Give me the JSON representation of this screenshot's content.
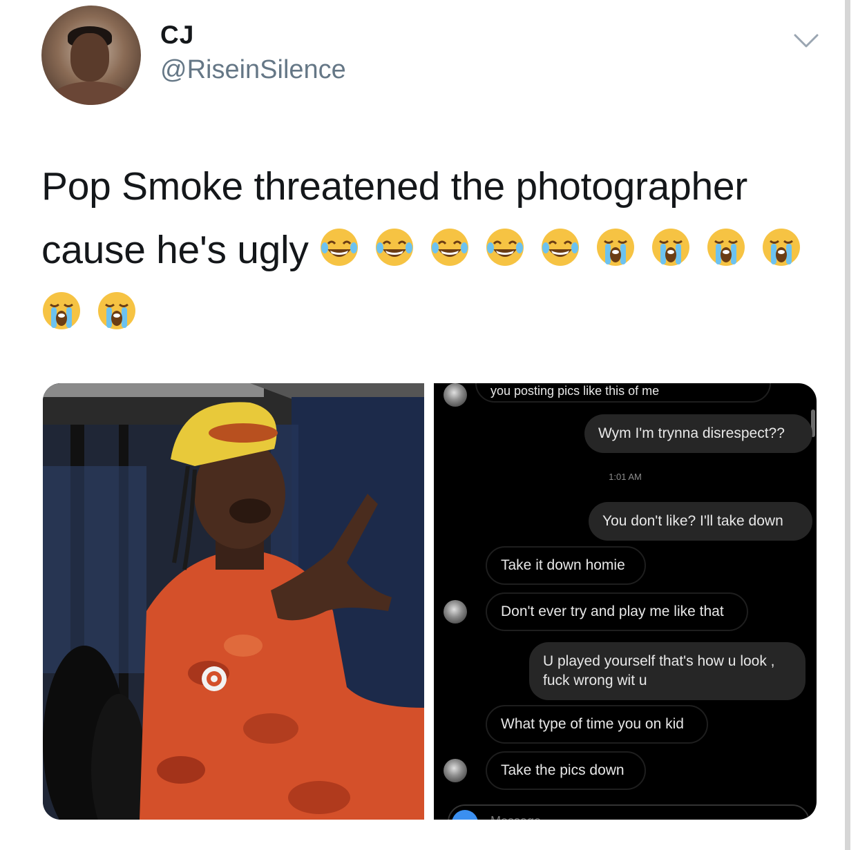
{
  "tweet": {
    "author_name": "CJ",
    "author_handle": "@RiseinSilence",
    "text": "Pop Smoke threatened the photographer cause he's ugly",
    "emojis": [
      "joy",
      "joy",
      "joy",
      "joy",
      "joy",
      "sob",
      "sob",
      "sob",
      "sob",
      "sob",
      "sob"
    ]
  },
  "media": {
    "chat": {
      "partial_top_message": "you posting pics like this of me",
      "messages": [
        {
          "from": "me",
          "text": "Wym I'm trynna disrespect??"
        },
        {
          "from": "time",
          "text": "1:01 AM"
        },
        {
          "from": "me",
          "text": "You don't like? I'll take down"
        },
        {
          "from": "them",
          "text": "Take it down homie"
        },
        {
          "from": "them",
          "text": "Don't ever try and play me like that"
        },
        {
          "from": "me",
          "text": "U played yourself that's how u look , fuck wrong wit u"
        },
        {
          "from": "them",
          "text": "What type of time you on kid"
        },
        {
          "from": "them",
          "text": "Take the pics down"
        }
      ],
      "compose_placeholder": "Message..."
    }
  },
  "colors": {
    "handle": "#657786",
    "chat_background": "#000000",
    "bubble_me": "#262626",
    "hoodie": "#d4502a",
    "cap": "#e8c93a"
  },
  "icons": [
    "chevron-down-icon",
    "camera-icon"
  ]
}
